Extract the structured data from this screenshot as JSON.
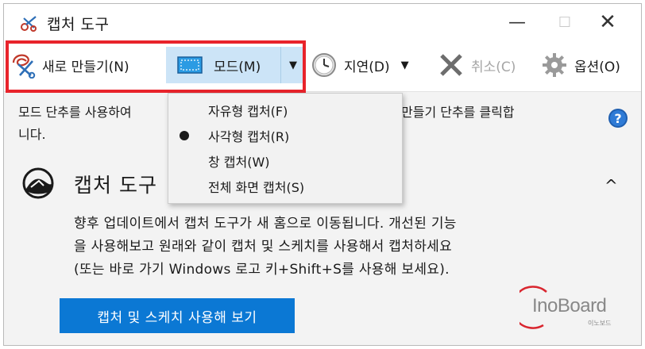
{
  "window": {
    "title": "캡처 도구",
    "minimize": "—",
    "maximize": "☐",
    "close": "✕"
  },
  "toolbar": {
    "new_label": "새로 만들기(N)",
    "mode_label": "모드(M)",
    "mode_arrow": "▼",
    "delay_label": "지연(D)",
    "delay_arrow": "▼",
    "cancel_label": "취소(C)",
    "options_label": "옵션(O)"
  },
  "info": {
    "line1": "모드 단추를 사용하여",
    "line1_right": "만들기 단추를 클릭합",
    "line2": "니다."
  },
  "mode_menu": {
    "items": [
      {
        "label": "자유형 캡처(F)",
        "selected": false
      },
      {
        "label": "사각형 캡처(R)",
        "selected": true
      },
      {
        "label": "창 캡처(W)",
        "selected": false
      },
      {
        "label": "전체 화면 캡처(S)",
        "selected": false
      }
    ]
  },
  "content": {
    "title": "캡처 도구",
    "collapse": "^",
    "body_line1": "향후 업데이트에서 캡처 도구가 새 홈으로 이동됩니다. 개선된 기능",
    "body_line2": "을 사용해보고 원래와 같이 캡처 및 스케치를 사용해서 캡처하세요",
    "body_line3": "(또는 바로 가기 Windows 로고 키+Shift+S를 사용해 보세요).",
    "cta_label": "캡처 및 스케치 사용해 보기"
  },
  "watermark": {
    "text": "InoBoard",
    "sub": "이노보드"
  },
  "colors": {
    "accent": "#0b78d4",
    "highlight": "#e8232b",
    "mode_bg": "#cce4f7"
  }
}
